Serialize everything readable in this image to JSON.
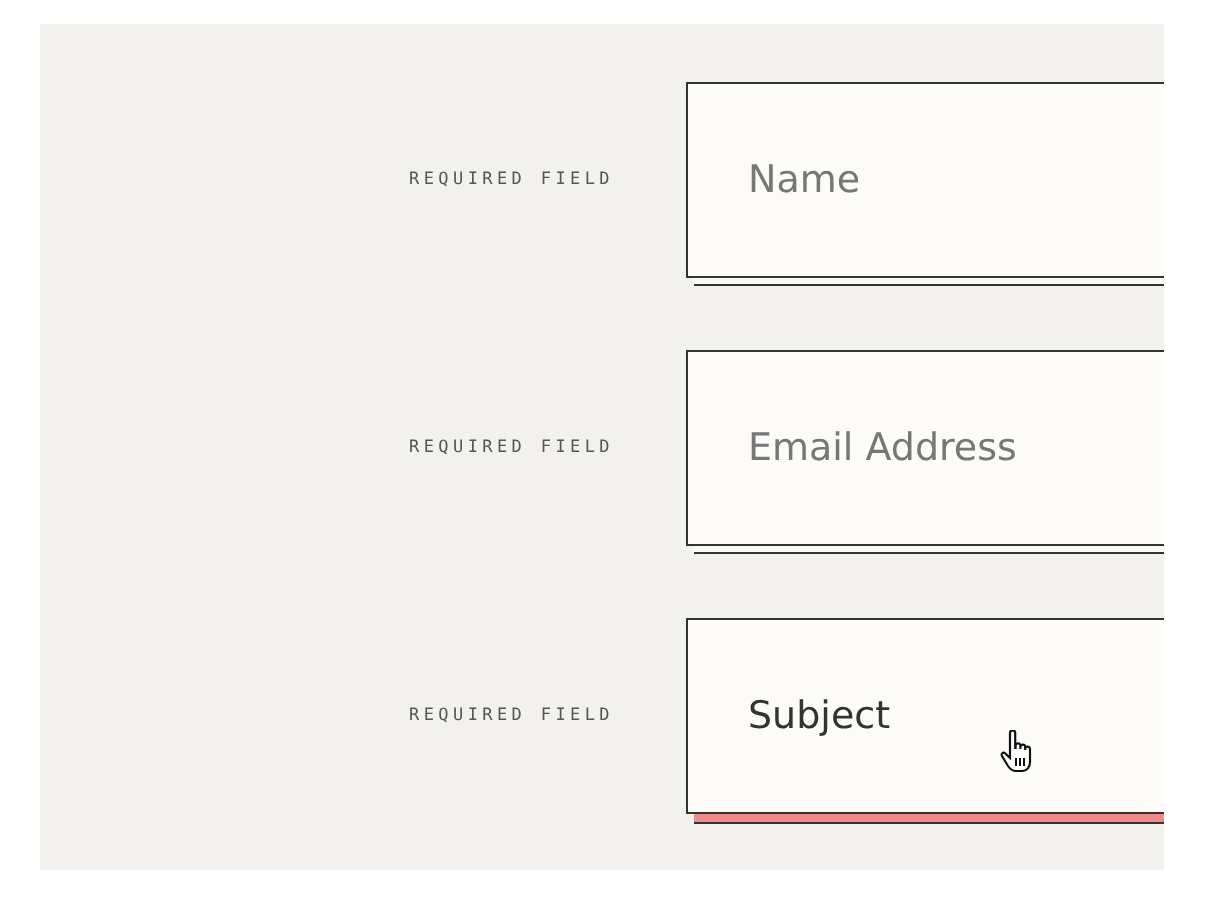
{
  "fields": [
    {
      "label": "REQUIRED FIELD",
      "placeholder": "Name",
      "hovered": false
    },
    {
      "label": "REQUIRED FIELD",
      "placeholder": "Email Address",
      "hovered": false
    },
    {
      "label": "REQUIRED FIELD",
      "placeholder": "Subject",
      "hovered": true
    }
  ]
}
